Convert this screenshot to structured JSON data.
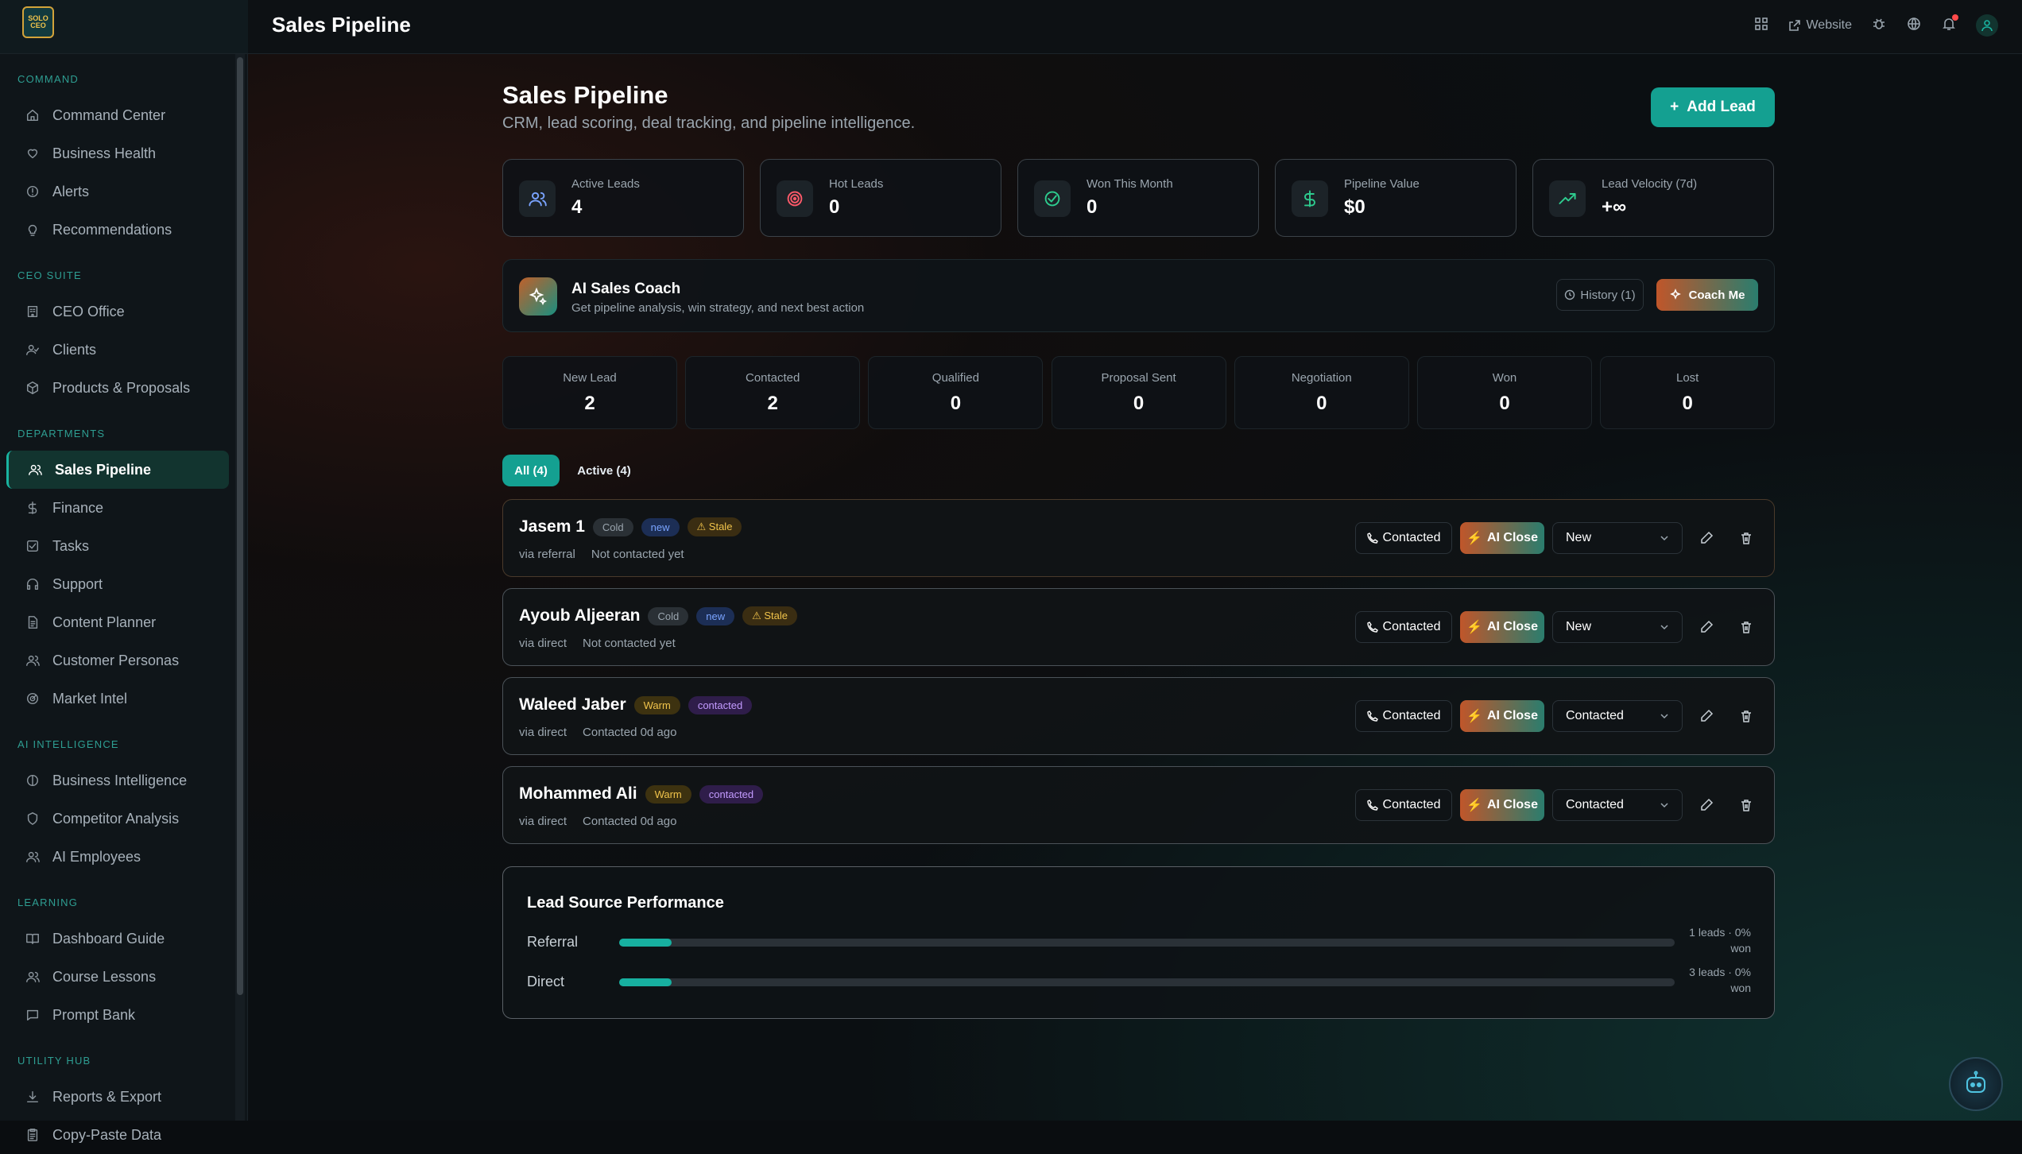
{
  "brand": {
    "logo_text": "SOLO CEO"
  },
  "topbar": {
    "title": "Sales Pipeline",
    "website_label": "Website"
  },
  "sidebar": {
    "sections": [
      {
        "title": "COMMAND",
        "items": [
          {
            "label": "Command Center",
            "icon": "home-icon"
          },
          {
            "label": "Business Health",
            "icon": "heart-icon"
          },
          {
            "label": "Alerts",
            "icon": "alert-circle-icon"
          },
          {
            "label": "Recommendations",
            "icon": "lightbulb-icon"
          }
        ]
      },
      {
        "title": "CEO SUITE",
        "items": [
          {
            "label": "CEO Office",
            "icon": "building-icon"
          },
          {
            "label": "Clients",
            "icon": "user-check-icon"
          },
          {
            "label": "Products & Proposals",
            "icon": "package-icon"
          }
        ]
      },
      {
        "title": "DEPARTMENTS",
        "items": [
          {
            "label": "Sales Pipeline",
            "icon": "users-icon",
            "active": true
          },
          {
            "label": "Finance",
            "icon": "dollar-icon"
          },
          {
            "label": "Tasks",
            "icon": "checkbox-icon"
          },
          {
            "label": "Support",
            "icon": "headphones-icon"
          },
          {
            "label": "Content Planner",
            "icon": "document-icon"
          },
          {
            "label": "Customer Personas",
            "icon": "users-icon"
          },
          {
            "label": "Market Intel",
            "icon": "radar-icon"
          }
        ]
      },
      {
        "title": "AI INTELLIGENCE",
        "items": [
          {
            "label": "Business Intelligence",
            "icon": "brain-icon"
          },
          {
            "label": "Competitor Analysis",
            "icon": "shield-icon"
          },
          {
            "label": "AI Employees",
            "icon": "users-icon"
          }
        ]
      },
      {
        "title": "LEARNING",
        "items": [
          {
            "label": "Dashboard Guide",
            "icon": "book-icon"
          },
          {
            "label": "Course Lessons",
            "icon": "users-icon"
          },
          {
            "label": "Prompt Bank",
            "icon": "message-icon"
          }
        ]
      },
      {
        "title": "UTILITY HUB",
        "items": [
          {
            "label": "Reports & Export",
            "icon": "download-icon"
          },
          {
            "label": "Copy-Paste Data",
            "icon": "clipboard-icon"
          }
        ]
      }
    ]
  },
  "page": {
    "title": "Sales Pipeline",
    "subtitle": "CRM, lead scoring, deal tracking, and pipeline intelligence.",
    "add_lead_label": "Add Lead"
  },
  "stats": [
    {
      "label": "Active Leads",
      "value": "4",
      "icon": "users-icon",
      "color": "#7aa4ff"
    },
    {
      "label": "Hot Leads",
      "value": "0",
      "icon": "target-icon",
      "color": "#ff5a6a"
    },
    {
      "label": "Won This Month",
      "value": "0",
      "icon": "check-circle-icon",
      "color": "#2ecc8f"
    },
    {
      "label": "Pipeline Value",
      "value": "$0",
      "icon": "dollar-icon",
      "color": "#2ecc8f"
    },
    {
      "label": "Lead Velocity (7d)",
      "value": "+∞",
      "icon": "trending-up-icon",
      "color": "#2ecc8f"
    }
  ],
  "coach": {
    "title": "AI Sales Coach",
    "subtitle": "Get pipeline analysis, win strategy, and next best action",
    "history_label": "History (1)",
    "button_label": "Coach Me"
  },
  "stages": [
    {
      "label": "New Lead",
      "value": "2"
    },
    {
      "label": "Contacted",
      "value": "2"
    },
    {
      "label": "Qualified",
      "value": "0"
    },
    {
      "label": "Proposal Sent",
      "value": "0"
    },
    {
      "label": "Negotiation",
      "value": "0"
    },
    {
      "label": "Won",
      "value": "0"
    },
    {
      "label": "Lost",
      "value": "0"
    }
  ],
  "tabs": {
    "all": "All (4)",
    "active": "Active (4)"
  },
  "leads": [
    {
      "name": "Jasem 1",
      "temp": "Cold",
      "status": "new",
      "stale": "Stale",
      "source": "via referral",
      "contact": "Not contacted yet",
      "stage": "New"
    },
    {
      "name": "Ayoub Aljeeran",
      "temp": "Cold",
      "status": "new",
      "stale": "Stale",
      "source": "via direct",
      "contact": "Not contacted yet",
      "stage": "New"
    },
    {
      "name": "Waleed Jaber",
      "temp": "Warm",
      "status": "contacted",
      "stale": "",
      "source": "via direct",
      "contact": "Contacted 0d ago",
      "stage": "Contacted"
    },
    {
      "name": "Mohammed Ali",
      "temp": "Warm",
      "status": "contacted",
      "stale": "",
      "source": "via direct",
      "contact": "Contacted 0d ago",
      "stage": "Contacted"
    }
  ],
  "lead_actions": {
    "contacted": "Contacted",
    "ai_close": "AI Close"
  },
  "source_performance": {
    "title": "Lead Source Performance",
    "rows": [
      {
        "label": "Referral",
        "stat": "1 leads · 0% won",
        "fill_fraction": 0.05
      },
      {
        "label": "Direct",
        "stat": "3 leads · 0% won",
        "fill_fraction": 0.05
      }
    ]
  }
}
